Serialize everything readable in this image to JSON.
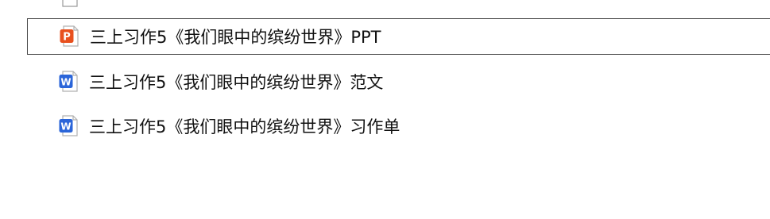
{
  "file_list": {
    "rows": [
      {
        "name": "",
        "icon": "document-icon-partial",
        "selected": false
      },
      {
        "name": "三上习作5《我们眼中的缤纷世界》PPT",
        "icon": "ppt-file-icon",
        "icon_letter": "P",
        "icon_color": "#E8501E",
        "selected": true
      },
      {
        "name": "三上习作5《我们眼中的缤纷世界》范文",
        "icon": "word-file-icon",
        "icon_letter": "W",
        "icon_color": "#2B65D9",
        "selected": false
      },
      {
        "name": "三上习作5《我们眼中的缤纷世界》习作单",
        "icon": "word-file-icon",
        "icon_letter": "W",
        "icon_color": "#2B65D9",
        "selected": false
      }
    ]
  }
}
